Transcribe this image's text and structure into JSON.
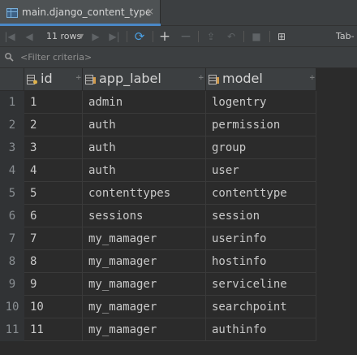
{
  "tab": {
    "title": "main.django_content_type",
    "close_glyph": "×",
    "icon": "table-icon",
    "accent": "#4a88c7"
  },
  "toolbar": {
    "first_glyph": "|◀",
    "prev_glyph": "◀",
    "rows_label": "11 rows",
    "rows_caret": "▼",
    "next_glyph": "▶",
    "last_glyph": "▶|",
    "refresh_glyph": "⟳",
    "add_glyph": "+",
    "remove_glyph": "−",
    "submit_glyph": "⇪",
    "revert_glyph": "↶",
    "stop_glyph": "■",
    "viewer_glyph": "⊞",
    "separator_label": "Tab-"
  },
  "filter": {
    "placeholder": "<Filter criteria>",
    "icon": "filter-funnel-icon"
  },
  "table": {
    "columns": [
      {
        "label": "id",
        "sort_glyph": "÷",
        "icon": "primary-key-column-icon"
      },
      {
        "label": "app_label",
        "sort_glyph": "÷",
        "icon": "column-icon"
      },
      {
        "label": "model",
        "sort_glyph": "÷",
        "icon": "column-icon"
      }
    ],
    "rows": [
      {
        "num": "1",
        "id": "1",
        "app_label": "admin",
        "model": "logentry"
      },
      {
        "num": "2",
        "id": "2",
        "app_label": "auth",
        "model": "permission"
      },
      {
        "num": "3",
        "id": "3",
        "app_label": "auth",
        "model": "group"
      },
      {
        "num": "4",
        "id": "4",
        "app_label": "auth",
        "model": "user"
      },
      {
        "num": "5",
        "id": "5",
        "app_label": "contenttypes",
        "model": "contenttype"
      },
      {
        "num": "6",
        "id": "6",
        "app_label": "sessions",
        "model": "session"
      },
      {
        "num": "7",
        "id": "7",
        "app_label": "my_mamager",
        "model": "userinfo"
      },
      {
        "num": "8",
        "id": "8",
        "app_label": "my_mamager",
        "model": "hostinfo"
      },
      {
        "num": "9",
        "id": "9",
        "app_label": "my_mamager",
        "model": "serviceline"
      },
      {
        "num": "10",
        "id": "10",
        "app_label": "my_mamager",
        "model": "searchpoint"
      },
      {
        "num": "11",
        "id": "11",
        "app_label": "my_mamager",
        "model": "authinfo"
      }
    ]
  }
}
